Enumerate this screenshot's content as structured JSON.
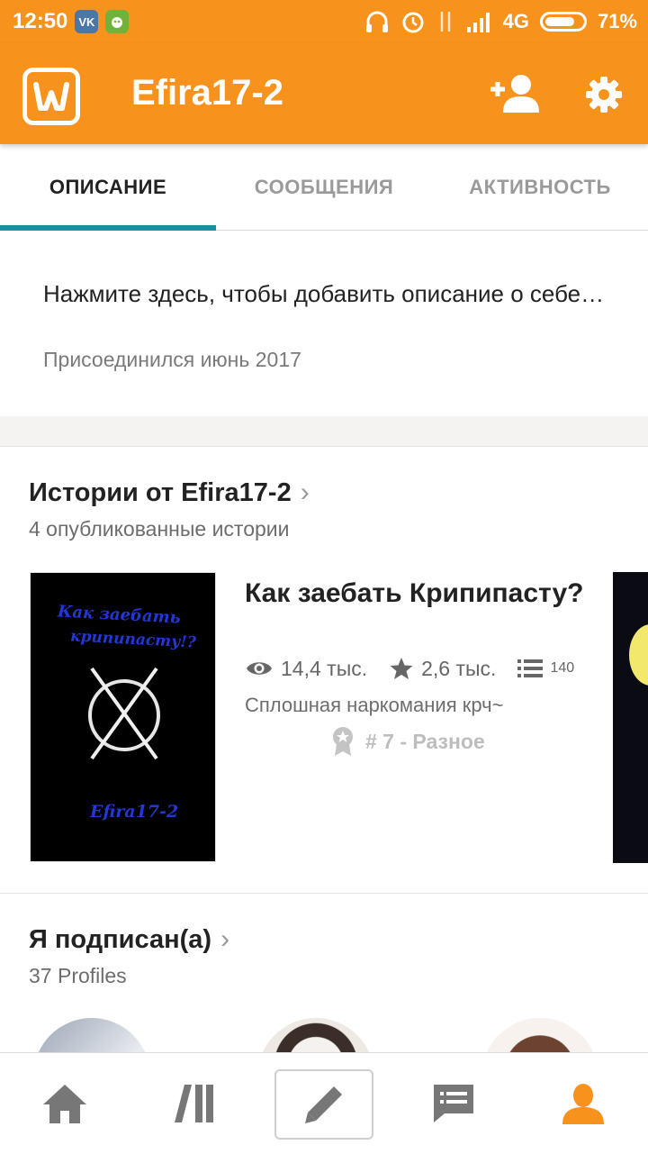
{
  "status_bar": {
    "time": "12:50",
    "app1": "VK",
    "network": "4G",
    "battery": "71%"
  },
  "app_bar": {
    "title": "Efira17-2",
    "logo_letter": "W"
  },
  "tabs": [
    {
      "label": "ОПИСАНИЕ",
      "active": true
    },
    {
      "label": "СООБЩЕНИЯ",
      "active": false
    },
    {
      "label": "АКТИВНОСТЬ",
      "active": false
    }
  ],
  "about": {
    "description": "Нажмите здесь, чтобы добавить описание о себе…",
    "joined": "Присоединился июнь 2017"
  },
  "stories": {
    "title": "Истории от Efira17-2",
    "subtitle": "4 опубликованные истории",
    "items": [
      {
        "cover_line1": "Как заебать",
        "cover_line2": "крипипасту!?",
        "cover_author": "Efira17-2",
        "title": "Как заебать Крипипасту?",
        "views": "14,4 тыс.",
        "votes": "2,6 тыс.",
        "parts": "140",
        "description": "Сплошная наркомания крч~",
        "rank": "# 7 - Разное"
      }
    ]
  },
  "following": {
    "title": "Я подписан(а)",
    "subtitle": "37 Profiles"
  },
  "colors": {
    "accent": "#F7931D",
    "tab_indicator": "#1A8DA0",
    "profile_active": "#F7931D"
  },
  "bottom_nav": [
    "home-icon",
    "library-icon",
    "write-icon",
    "messages-icon",
    "profile-icon"
  ]
}
